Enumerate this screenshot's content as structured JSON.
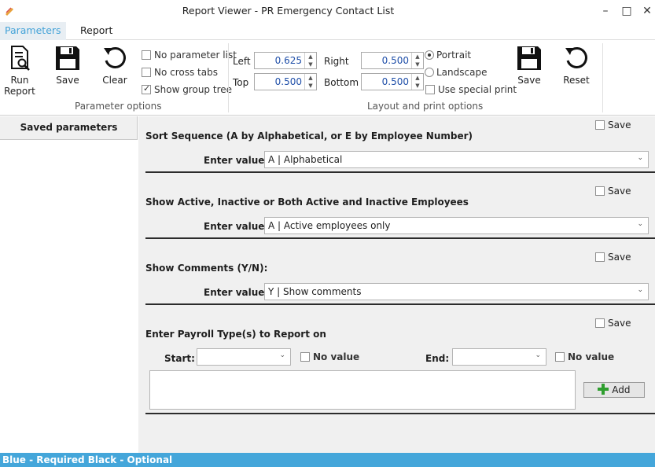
{
  "window": {
    "title": "Report Viewer - PR Emergency Contact List"
  },
  "tabs": [
    {
      "label": "Parameters"
    },
    {
      "label": "Report"
    }
  ],
  "ribbon": {
    "run_report": "Run\nReport",
    "run_report_l1": "Run",
    "run_report_l2": "Report",
    "save": "Save",
    "clear": "Clear",
    "options": {
      "no_parameter_list": "No parameter list",
      "no_cross_tabs": "No cross tabs",
      "show_group_tree": "Show group tree"
    },
    "parameter_options_label": "Parameter options",
    "layout": {
      "left_label": "Left",
      "left_value": "0.625",
      "top_label": "Top",
      "top_value": "0.500",
      "right_label": "Right",
      "right_value": "0.500",
      "bottom_label": "Bottom",
      "bottom_value": "0.500",
      "portrait": "Portrait",
      "landscape": "Landscape",
      "use_special_print": "Use special print"
    },
    "layout_save": "Save",
    "reset": "Reset",
    "layout_options_label": "Layout and print options"
  },
  "left_panel": {
    "title": "Saved parameters"
  },
  "sections": [
    {
      "title": "Sort Sequence (A by Alphabetical, or E by Employee Number)",
      "save": "Save",
      "enter_label": "Enter value:",
      "value": "A | Alphabetical"
    },
    {
      "title": "Show Active, Inactive or Both Active and Inactive Employees",
      "save": "Save",
      "enter_label": "Enter value:",
      "value": "A | Active employees only"
    },
    {
      "title": "Show Comments (Y/N):",
      "save": "Save",
      "enter_label": "Enter value:",
      "value": "Y | Show comments"
    }
  ],
  "payroll": {
    "title": "Enter Payroll Type(s) to Report on",
    "save": "Save",
    "start_label": "Start:",
    "end_label": "End:",
    "no_value": "No value",
    "add": "Add"
  },
  "status_bar": {
    "text": "Blue - Required   Black - Optional"
  },
  "colors": {
    "accent": "#44a6da",
    "tab_active": "#44a3d8",
    "value_blue": "#1e4ea8"
  }
}
